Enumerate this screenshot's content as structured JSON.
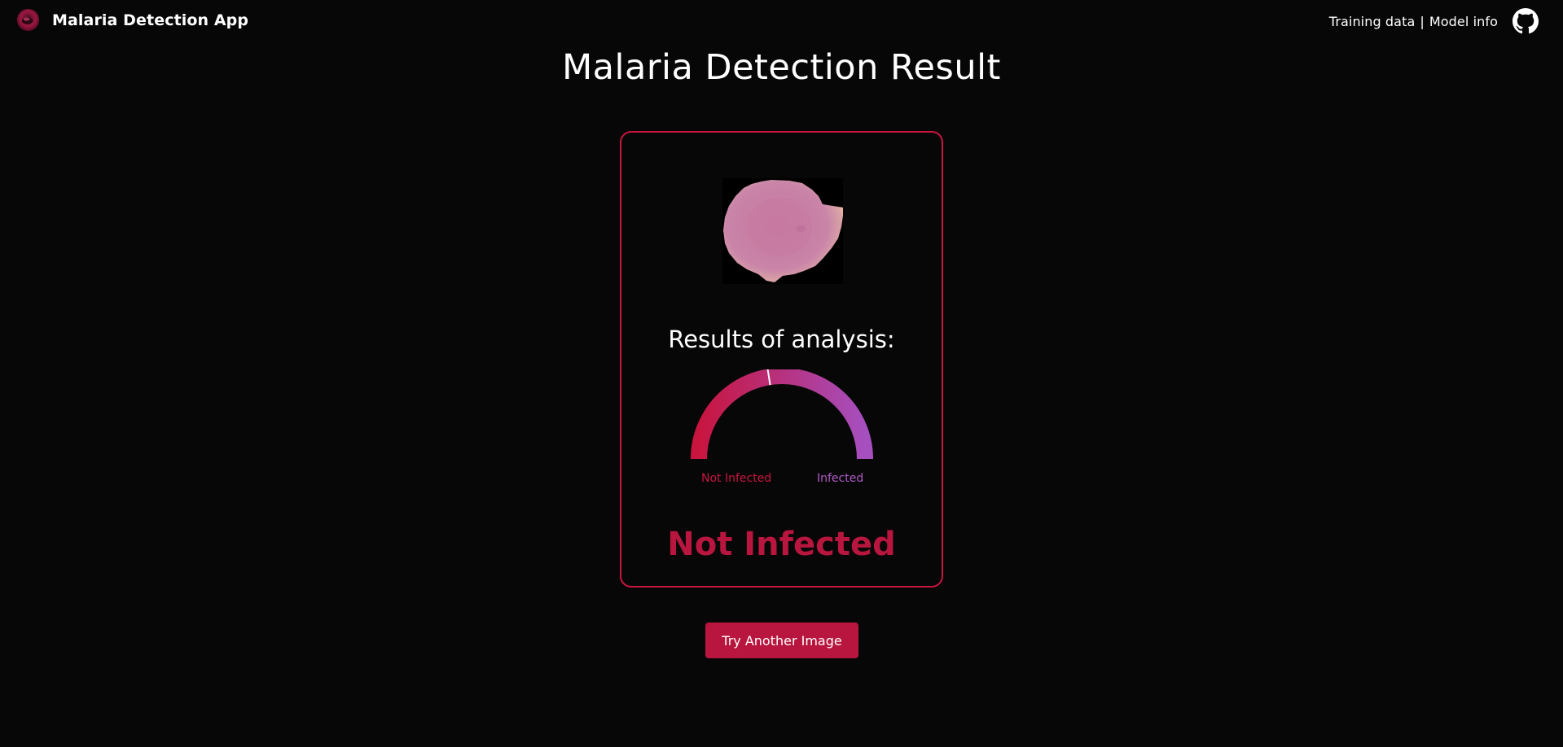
{
  "header": {
    "app_name": "Malaria Detection App",
    "logo_icon": "blood-cell-logo-icon",
    "nav": {
      "training_data": "Training data",
      "separator": "|",
      "model_info": "Model info"
    },
    "github_icon": "github-icon"
  },
  "main": {
    "title": "Malaria Detection Result",
    "card": {
      "image_subject": "cell-image",
      "results_heading": "Results of analysis:",
      "gauge": {
        "left_label": "Not Infected",
        "right_label": "Infected",
        "infection_probability": 0.45,
        "colors": {
          "start": "#c8153f",
          "end": "#a64fbf",
          "needle": "#ffffff"
        }
      },
      "verdict": "Not Infected"
    },
    "action_button": "Try Another Image"
  },
  "colors": {
    "background": "#080708",
    "accent": "#b8163e",
    "card_border": "#c8153f",
    "infected": "#b05ac6"
  }
}
